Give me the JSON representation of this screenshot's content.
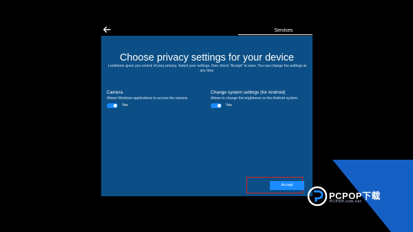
{
  "header": {
    "back_icon": "arrow-left-icon",
    "tab_label": "Services"
  },
  "dialog": {
    "title": "Choose privacy settings for your device",
    "intro": "LoniHonor gives you control of your privacy. Select your settings, then check \"Accept\" to save. You can change the settings at any time.",
    "settings": [
      {
        "title": "Camera",
        "description": "Allows Windows applications to access the camera.",
        "toggle_state": "on",
        "toggle_label": "Yes"
      },
      {
        "title": "Change system settings (for Android)",
        "description": "Allows to change the brightness on the Android system.",
        "toggle_state": "on",
        "toggle_label": "Yes"
      }
    ],
    "accept_label": "Accept"
  },
  "colors": {
    "background": "#000000",
    "panel": "#0c4f86",
    "accent": "#1a8cff",
    "highlight_border": "#e02020"
  },
  "watermark": {
    "brand": "PCPOP下载",
    "sub": "PCPOP.com.net"
  }
}
